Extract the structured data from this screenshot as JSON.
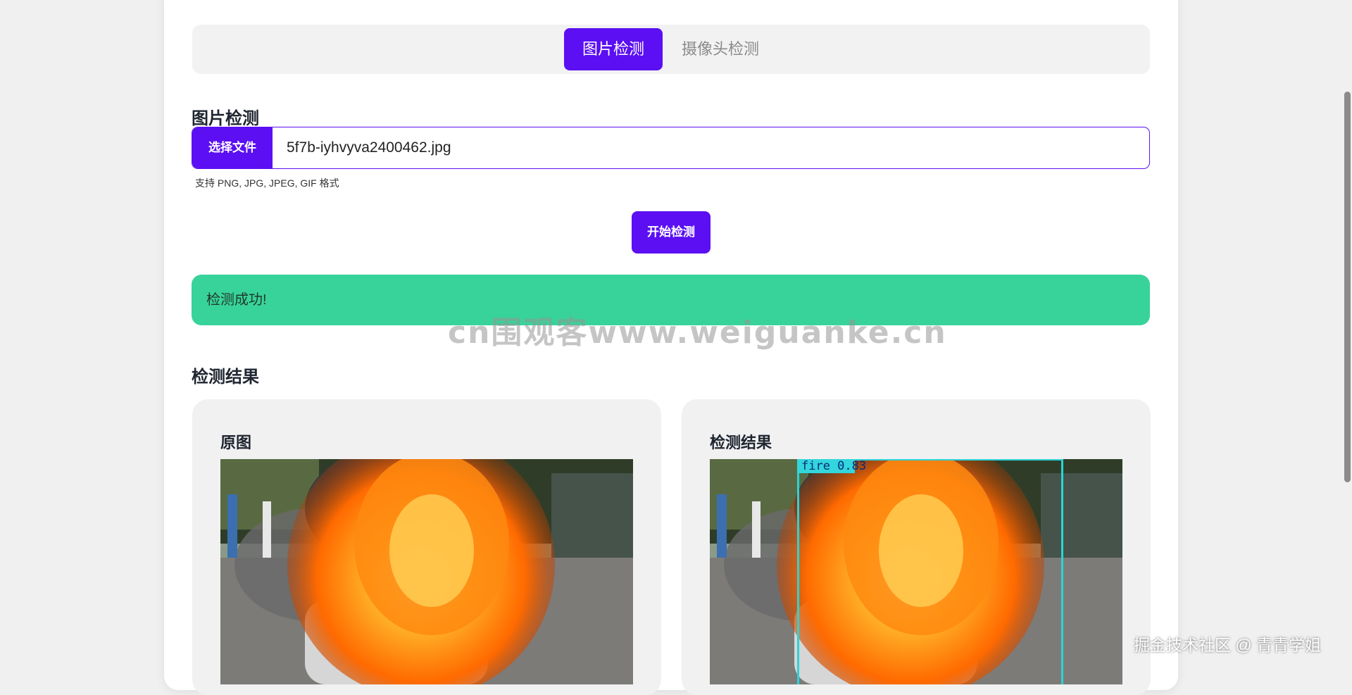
{
  "tabs": [
    {
      "label": "图片检测",
      "active": true
    },
    {
      "label": "摄像头检测",
      "active": false
    }
  ],
  "upload": {
    "title": "图片检测",
    "choose_button": "选择文件",
    "file_name": "5f7b-iyhvyva2400462.jpg",
    "hint": "支持 PNG, JPG, JPEG, GIF 格式"
  },
  "actions": {
    "start": "开始检测"
  },
  "status": {
    "message": "检测成功!",
    "color": "#38d39a"
  },
  "watermark": "cn围观客www.weiguanke.cn",
  "results": {
    "title": "检测结果",
    "original_title": "原图",
    "detected_title": "检测结果",
    "detection_label": "fire 0.83"
  },
  "footer": {
    "credit": "掘金技术社区 @ 青青学姐"
  },
  "colors": {
    "accent": "#5b0ff2",
    "success": "#38d39a",
    "box": "#2bd3d8"
  }
}
